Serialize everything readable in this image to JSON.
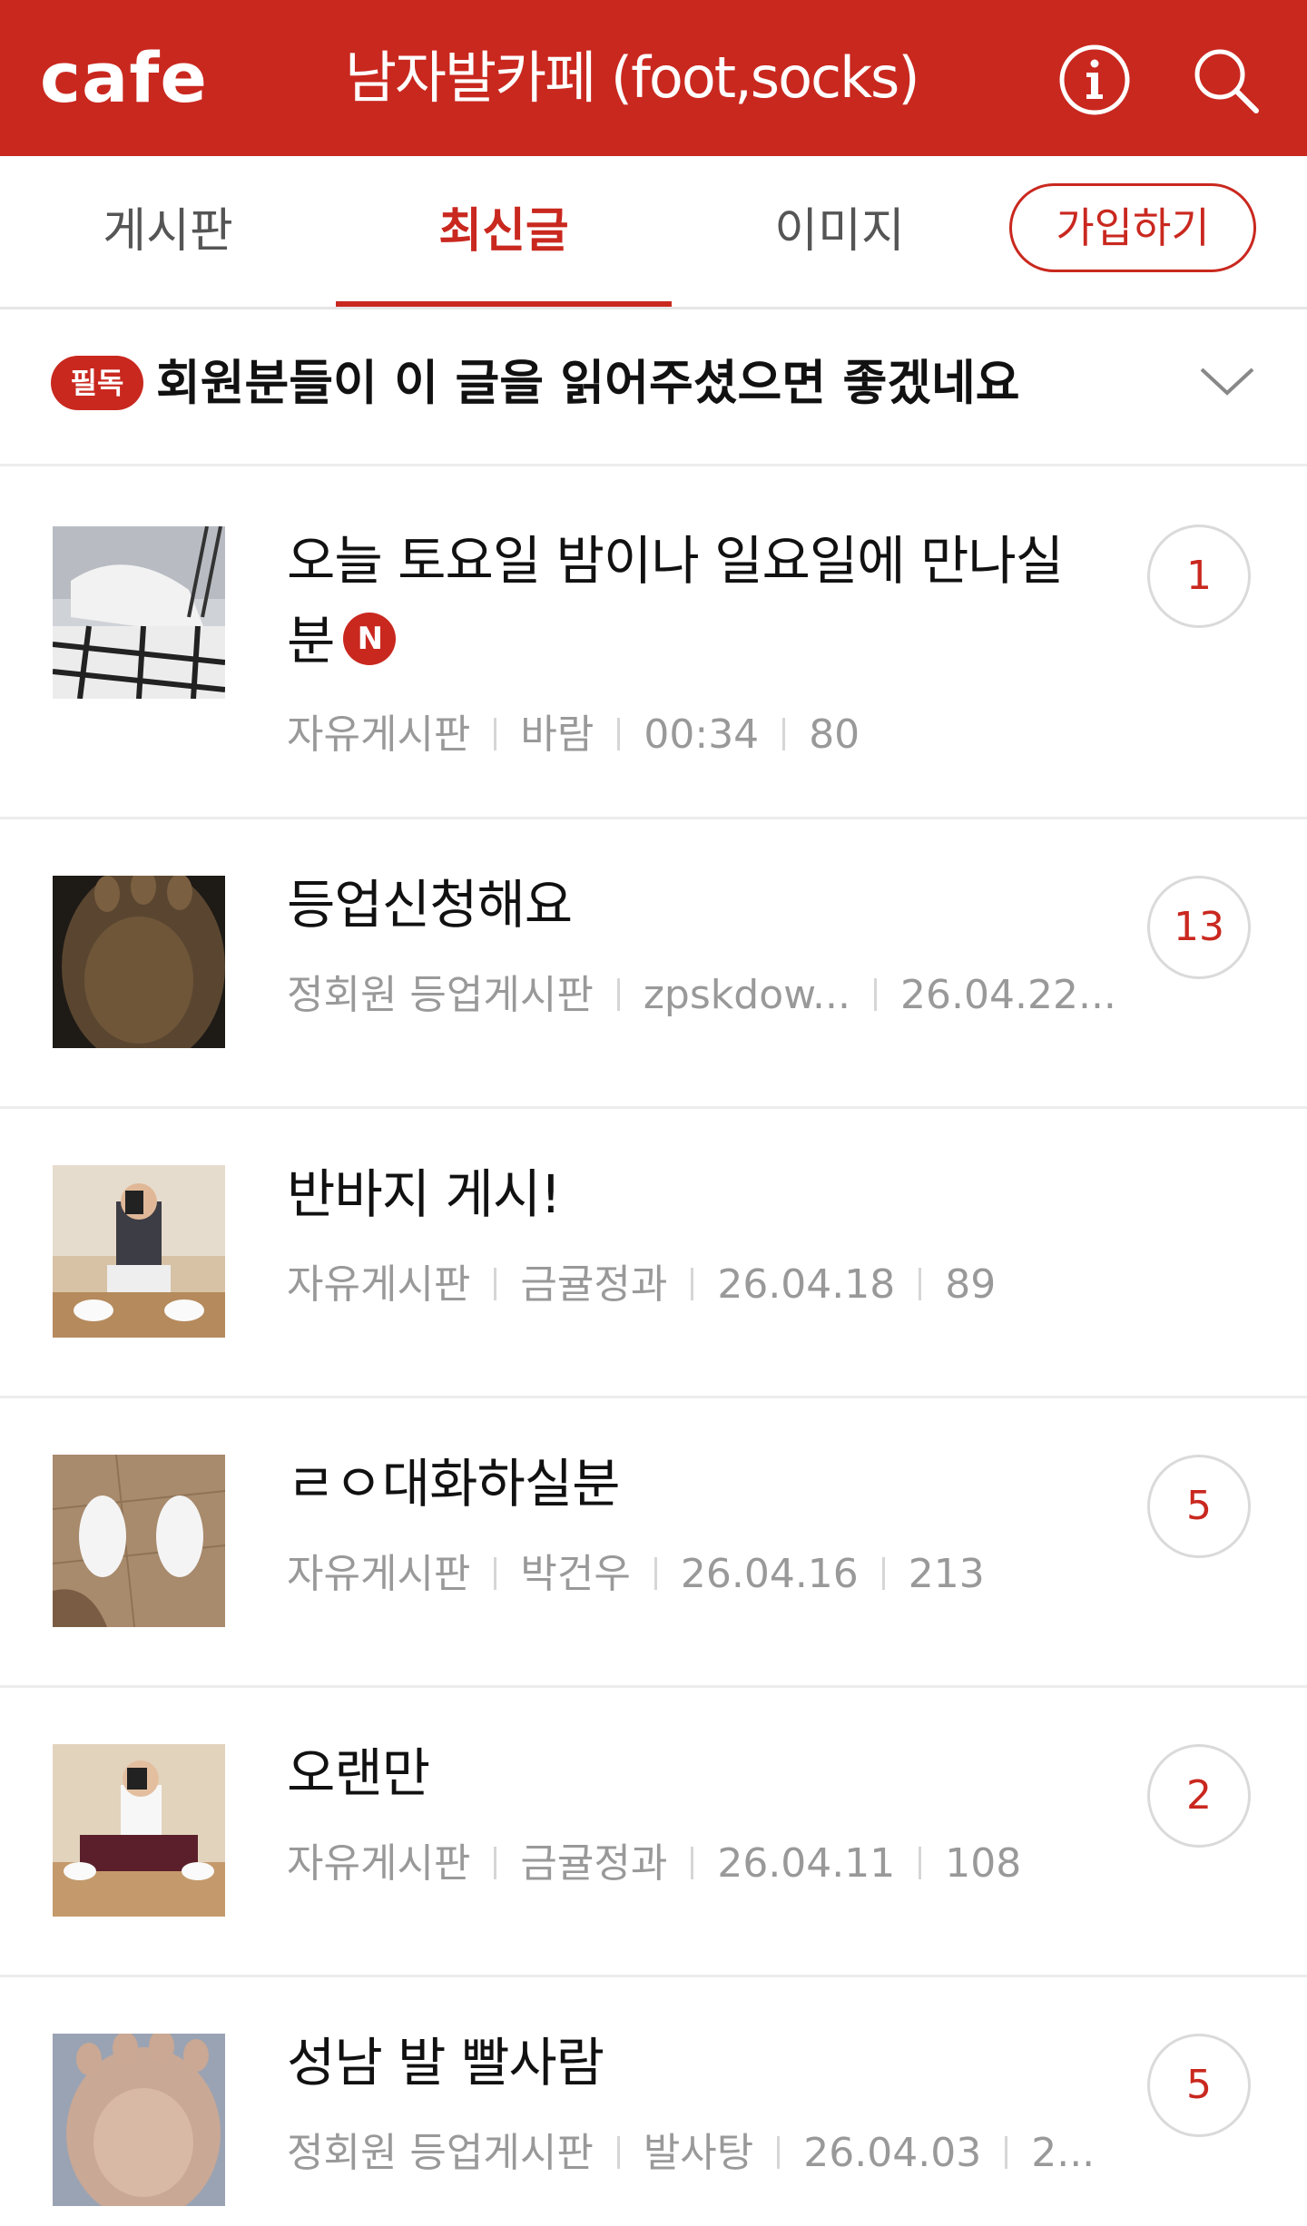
{
  "header": {
    "logo": "cafe",
    "cafe_name": "남자발카페 (foot,socks)",
    "info_icon": "info-icon",
    "search_icon": "search-icon",
    "brand_color": "#c9281f"
  },
  "tabs": [
    {
      "label": "게시판",
      "active": false
    },
    {
      "label": "최신글",
      "active": true
    },
    {
      "label": "이미지",
      "active": false
    }
  ],
  "join_button": "가입하기",
  "notice": {
    "badge": "필독",
    "text": "회원분들이 이 글을 읽어주셨으면 좋겠네요",
    "chevron_icon": "chevron-down-icon"
  },
  "posts": [
    {
      "title": "오늘 토요일 밤이나 일요일에 만나실분",
      "title_line1": "오늘 토요일 밤이나 일요일에 만나실",
      "title_line2": "분",
      "is_new": true,
      "new_badge": "N",
      "board": "자유게시판",
      "author": "바람",
      "date": "00:34",
      "views": "80",
      "comments": "1"
    },
    {
      "title": "등업신청해요",
      "board": "정회원 등업게시판",
      "author": "zpskdow...",
      "date": "26.04.22...",
      "comments": "13"
    },
    {
      "title": "반바지 게시!",
      "board": "자유게시판",
      "author": "금귤정과",
      "date": "26.04.18",
      "views": "89"
    },
    {
      "title": "ㄹㅇ대화하실분",
      "board": "자유게시판",
      "author": "박건우",
      "date": "26.04.16",
      "views": "213",
      "comments": "5"
    },
    {
      "title": "오랜만",
      "board": "자유게시판",
      "author": "금귤정과",
      "date": "26.04.11",
      "views": "108",
      "comments": "2"
    },
    {
      "title": "성남 발 빨사람",
      "board": "정회원 등업게시판",
      "author": "발사탕",
      "date": "26.04.03",
      "views": "2...",
      "comments": "5"
    }
  ]
}
